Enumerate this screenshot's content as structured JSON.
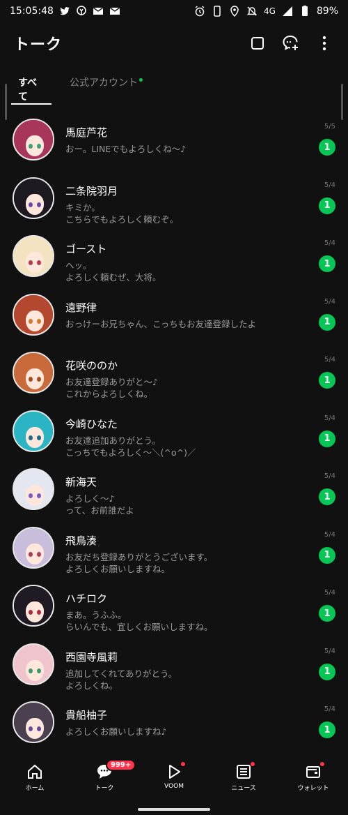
{
  "status_bar": {
    "time": "15:05:48",
    "network": "4G",
    "battery": "89%"
  },
  "header": {
    "title": "トーク"
  },
  "tabs": [
    {
      "label": "すべて",
      "active": true
    },
    {
      "label": "公式アカウント",
      "active": false
    }
  ],
  "chats": [
    {
      "name": "馬庭芦花",
      "message": "おー。LINEでもよろしくね〜♪",
      "date": "5/5",
      "unread": "1",
      "hair": "#a8355a",
      "eye": "#3aa37a"
    },
    {
      "name": "二条院羽月",
      "message": "キミか。\nこちらでもよろしく頼むぞ。",
      "date": "5/4",
      "unread": "1",
      "hair": "#1e1a22",
      "eye": "#6a4aa8"
    },
    {
      "name": "ゴースト",
      "message": "ヘッ。\nよろしく頼むぜ、大将。",
      "date": "5/4",
      "unread": "1",
      "hair": "#f3e3c0",
      "eye": "#b83a4a"
    },
    {
      "name": "遠野律",
      "message": "おっけーお兄ちゃん、こっちもお友達登録したよ",
      "date": "5/4",
      "unread": "1",
      "hair": "#b4482e",
      "eye": "#d07a2a"
    },
    {
      "name": "花咲ののか",
      "message": "お友達登録ありがと〜♪\nこれからよろしくね。",
      "date": "5/4",
      "unread": "1",
      "hair": "#c86a3a",
      "eye": "#a05020"
    },
    {
      "name": "今崎ひなた",
      "message": "お友達追加ありがとう。\nこっちでもよろしく〜＼(^o^)／",
      "date": "5/4",
      "unread": "1",
      "hair": "#2ab4c4",
      "eye": "#1a6a8a"
    },
    {
      "name": "新海天",
      "message": "よろしく〜♪\nって、お前誰だよ",
      "date": "5/4",
      "unread": "1",
      "hair": "#e4e6f0",
      "eye": "#7a5ac8"
    },
    {
      "name": "飛鳥湊",
      "message": "お友だち登録ありがとうございます。\nよろしくお願いしますね。",
      "date": "5/4",
      "unread": "1",
      "hair": "#c8bedc",
      "eye": "#b03a5a"
    },
    {
      "name": "ハチロク",
      "message": "まあ。うふふ。\nらいんでも、宜しくお願いしますね。",
      "date": "5/4",
      "unread": "1",
      "hair": "#201a24",
      "eye": "#b02a3a"
    },
    {
      "name": "西園寺風莉",
      "message": "追加してくれてありがとう。\nよろしくね。",
      "date": "5/4",
      "unread": "1",
      "hair": "#f0c4cc",
      "eye": "#3a9a6a"
    },
    {
      "name": "貴船柚子",
      "message": "よろしくお願いしますね♪",
      "date": "5/4",
      "unread": "1",
      "hair": "#4a4050",
      "eye": "#6a4a9a"
    }
  ],
  "bottom_nav": {
    "home": "ホーム",
    "talk": "トーク",
    "talk_badge": "999+",
    "voom": "VOOM",
    "news": "ニュース",
    "wallet": "ウォレット"
  },
  "colors": {
    "accent_green": "#06c755",
    "badge_red": "#ff334b",
    "background": "#111111"
  }
}
